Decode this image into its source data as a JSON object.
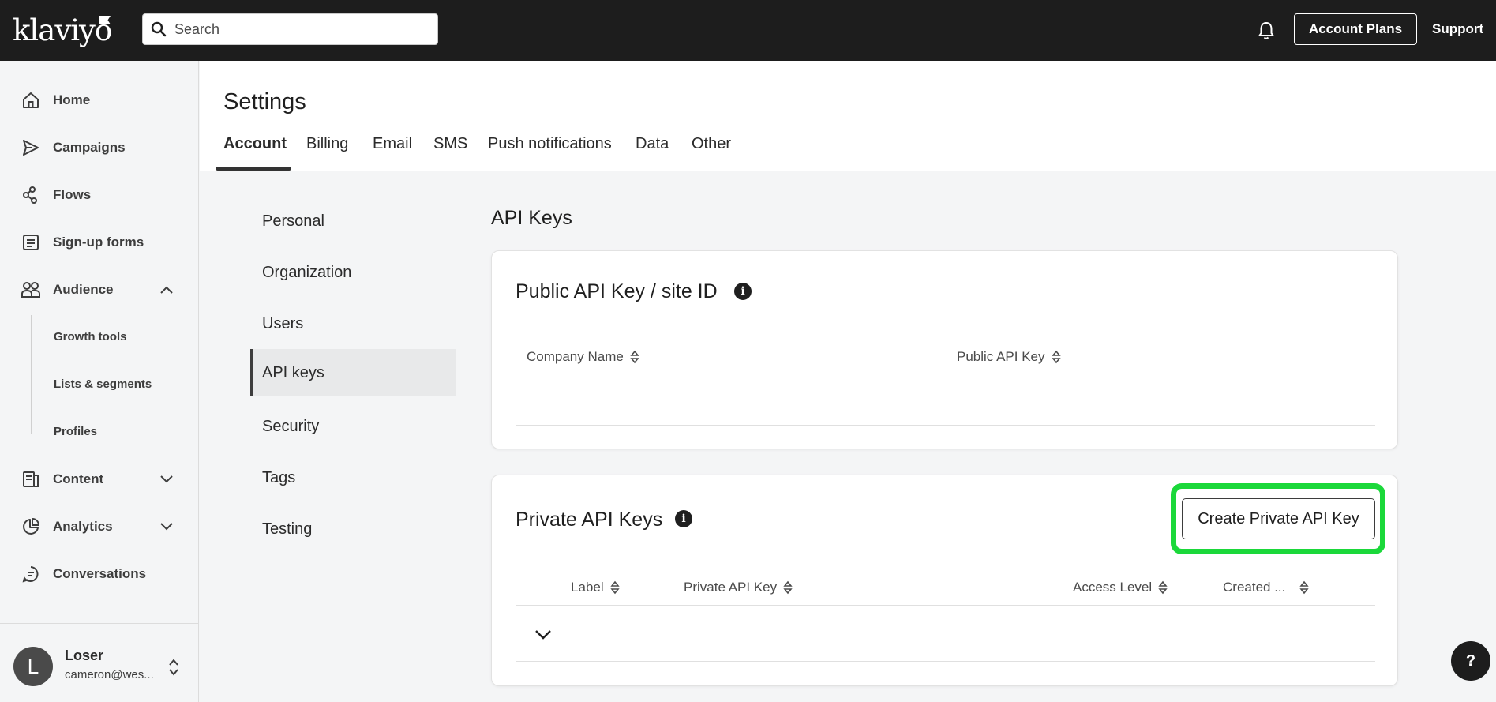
{
  "brand": {
    "logo_text": "klaviyo"
  },
  "topbar": {
    "search_placeholder": "Search",
    "account_plans_label": "Account Plans",
    "support_label": "Support"
  },
  "sidebar": {
    "items": [
      {
        "label": "Home",
        "icon": "home-icon"
      },
      {
        "label": "Campaigns",
        "icon": "send-icon"
      },
      {
        "label": "Flows",
        "icon": "flows-icon"
      },
      {
        "label": "Sign-up forms",
        "icon": "form-icon"
      },
      {
        "label": "Audience",
        "icon": "people-icon",
        "expanded": true
      },
      {
        "label": "Content",
        "icon": "content-icon",
        "expanded": false
      },
      {
        "label": "Analytics",
        "icon": "chart-icon",
        "expanded": false
      },
      {
        "label": "Conversations",
        "icon": "chat-icon"
      }
    ],
    "audience_sub": [
      "Growth tools",
      "Lists & segments",
      "Profiles"
    ],
    "user": {
      "initial": "L",
      "name": "Loser",
      "email": "cameron@wes..."
    }
  },
  "header": {
    "title": "Settings",
    "tabs": [
      "Account",
      "Billing",
      "Email",
      "SMS",
      "Push notifications",
      "Data",
      "Other"
    ],
    "active_tab": "Account"
  },
  "settings_menu": {
    "items": [
      "Personal",
      "Organization",
      "Users",
      "API keys",
      "Security",
      "Tags",
      "Testing"
    ],
    "active": "API keys"
  },
  "content": {
    "section_title": "API Keys",
    "public_card": {
      "title": "Public API Key / site ID",
      "columns": [
        "Company Name",
        "Public API Key"
      ]
    },
    "private_card": {
      "title": "Private API Keys",
      "create_button": "Create Private API Key",
      "columns": [
        "Label",
        "Private API Key",
        "Access Level",
        "Created ..."
      ]
    }
  },
  "help_label": "?",
  "colors": {
    "topbar": "#1d1d1d",
    "highlight": "#1bd83a"
  }
}
